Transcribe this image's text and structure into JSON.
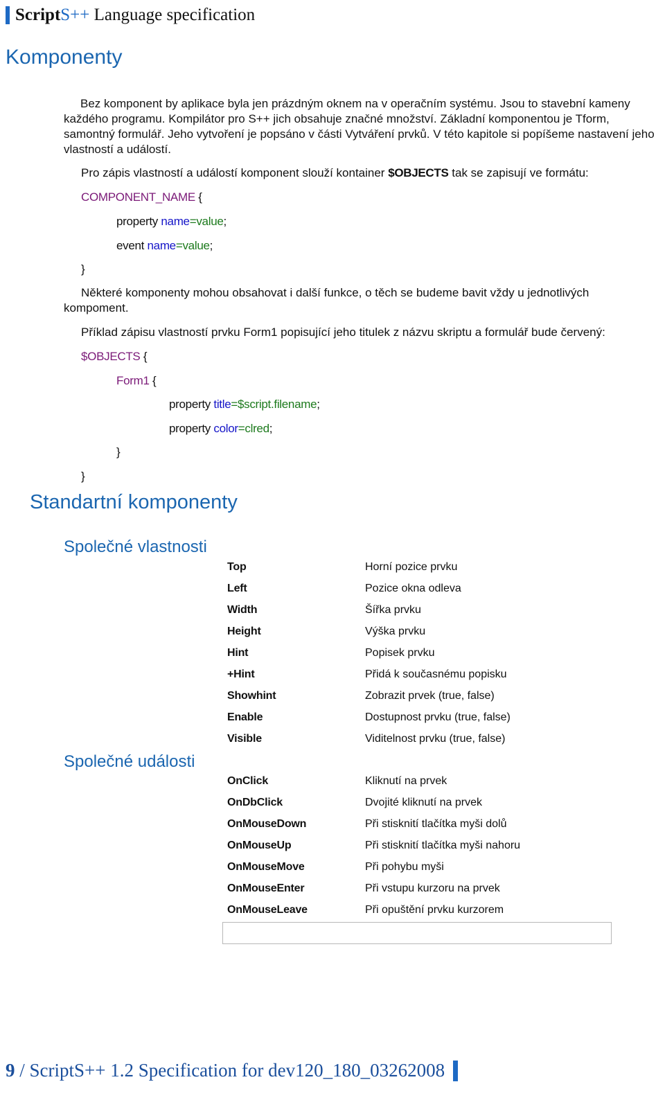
{
  "header": {
    "title_bold": "Script",
    "title_accent": "S++",
    "title_rest": " Language specification"
  },
  "section": {
    "title": "Komponenty",
    "intro": "Bez komponent by aplikace byla jen prázdným oknem na v operačním systému. Jsou to stavební kameny každého programu. Kompilátor pro S++ jich obsahuje značné množství. Základní komponentou je Tform, samontný formulář. Jeho vytvoření je popsáno v části Vytváření prvků. V této kapitole si popíšeme nastavení jeho vlastností a událostí.",
    "format_intro_before": "Pro zápis vlastností a událostí komponent slouží kontainer ",
    "format_intro_keyword": "$OBJECTS",
    "format_intro_after": " tak se zapisují ve formátu:",
    "format_code": {
      "component": "COMPONENT_NAME",
      "open_brace": " {",
      "property_kw": "property ",
      "event_kw": "event ",
      "name": "name",
      "equals": "=",
      "value": "value",
      "semicolon": ";",
      "close_brace": "}"
    },
    "note_line1": "Některé komponenty mohou obsahovat i další funkce, o těch se budeme bavit vždy u jednotlivých",
    "note_line2": "kompoment.",
    "example_intro": "Příklad zápisu vlastností prvku Form1 popisující jeho titulek z názvu skriptu a formulář bude červený:",
    "example_code": {
      "container": "$OBJECTS",
      "component": "Form1",
      "open_brace": " {",
      "property_kw": "property ",
      "prop1_name": "title",
      "prop1_value": "$script.filename",
      "prop2_name": "color",
      "prop2_value": "clred",
      "equals": "=",
      "semicolon": ";",
      "close_brace": "}"
    }
  },
  "standard": {
    "title": "Standartní komponenty",
    "properties_title": "Společné vlastnosti",
    "properties": [
      {
        "name": "Top",
        "desc": "Horní pozice prvku"
      },
      {
        "name": "Left",
        "desc": "Pozice okna odleva"
      },
      {
        "name": "Width",
        "desc": "Šířka prvku"
      },
      {
        "name": "Height",
        "desc": "Výška prvku"
      },
      {
        "name": "Hint",
        "desc": "Popisek prvku"
      },
      {
        "name": "+Hint",
        "desc": "Přidá k současnému popisku"
      },
      {
        "name": "Showhint",
        "desc": "Zobrazit prvek (true, false)"
      },
      {
        "name": "Enable",
        "desc": "Dostupnost prvku (true, false)"
      },
      {
        "name": "Visible",
        "desc": "Viditelnost prvku (true, false)"
      }
    ],
    "events_title": "Společné události",
    "events": [
      {
        "name": "OnClick",
        "desc": "Kliknutí na prvek"
      },
      {
        "name": "OnDbClick",
        "desc": "Dvojité kliknutí na prvek"
      },
      {
        "name": "OnMouseDown",
        "desc": "Při stisknití tlačítka myši dolů"
      },
      {
        "name": "OnMouseUp",
        "desc": "Při stisknití tlačítka myši nahoru"
      },
      {
        "name": "OnMouseMove",
        "desc": "Při pohybu myši"
      },
      {
        "name": "OnMouseEnter",
        "desc": "Při vstupu kurzoru na prvek"
      },
      {
        "name": "OnMouseLeave",
        "desc": "Při opuštění prvku kurzorem"
      }
    ]
  },
  "footer": {
    "page_number": "9",
    "text": " / ScriptS++ 1.2 Specification for dev120_180_03262008"
  },
  "colors": {
    "accent": "#1e6ac4",
    "heading": "#1b66b0",
    "code_component": "#7b1a78",
    "code_name": "#1515c8",
    "code_value": "#1d7a1d"
  }
}
